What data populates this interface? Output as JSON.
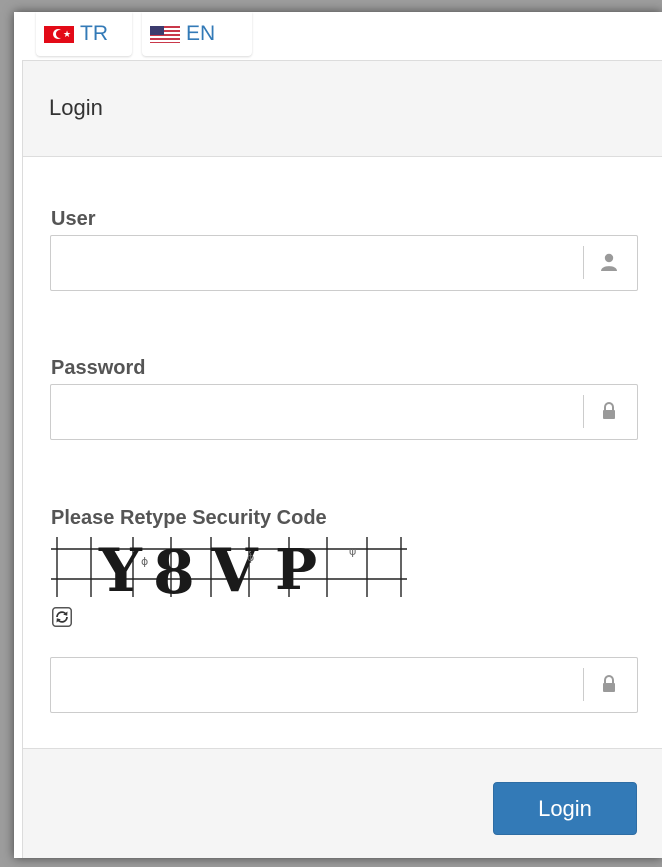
{
  "languages": [
    {
      "code": "TR",
      "label": "TR",
      "flag_icon": "turkey-flag-icon"
    },
    {
      "code": "EN",
      "label": "EN",
      "flag_icon": "usa-flag-icon"
    }
  ],
  "panel": {
    "title": "Login"
  },
  "form": {
    "user": {
      "label": "User",
      "value": "",
      "placeholder": "",
      "icon": "user-icon"
    },
    "password": {
      "label": "Password",
      "value": "",
      "placeholder": "",
      "icon": "lock-icon"
    },
    "security": {
      "label": "Please Retype Security Code",
      "captcha_text": "Y8VP",
      "refresh_icon": "refresh-icon",
      "value": "",
      "placeholder": "",
      "icon": "lock-icon"
    }
  },
  "footer": {
    "login_label": "Login"
  },
  "colors": {
    "primary": "#337ab7",
    "link": "#337ab7",
    "panel_bg": "#f5f5f5",
    "border": "#cccccc"
  }
}
